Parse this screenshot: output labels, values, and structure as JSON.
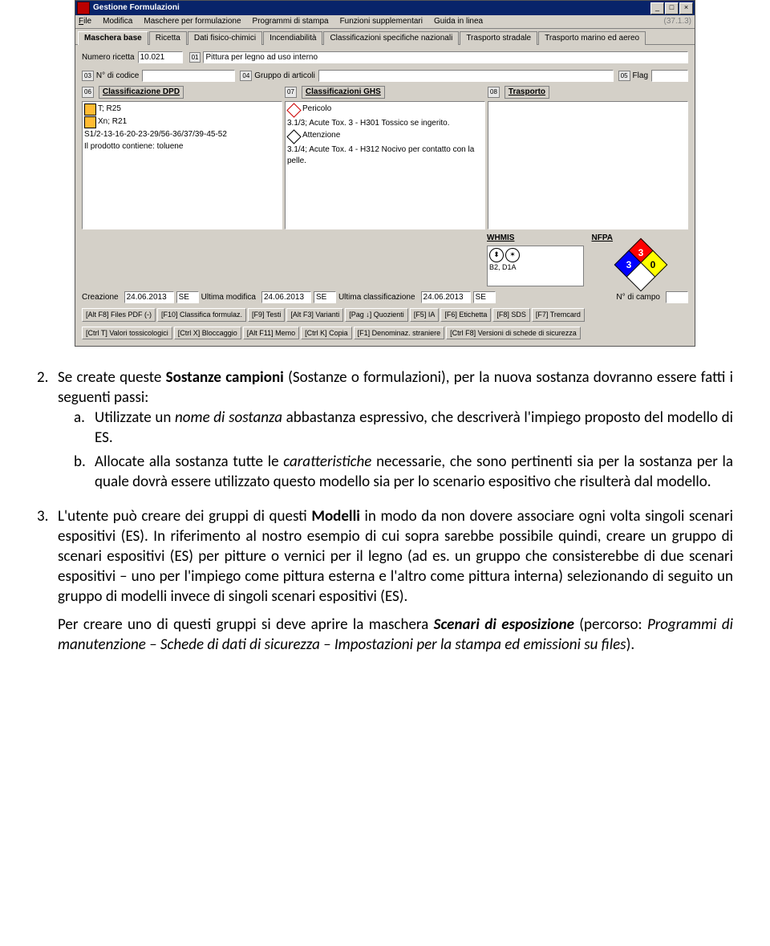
{
  "window": {
    "title": "Gestione Formulazioni",
    "version": "(37.1.3)",
    "btn_min": "_",
    "btn_max": "□",
    "btn_close": "×"
  },
  "menus": {
    "file": "File",
    "modifica": "Modifica",
    "maschere": "Maschere per formulazione",
    "programmi": "Programmi di stampa",
    "funzioni": "Funzioni supplementari",
    "guida": "Guida in linea"
  },
  "tabs": [
    "Maschera base",
    "Ricetta",
    "Dati fisico-chimici",
    "Incendiabilità",
    "Classificazioni specifiche nazionali",
    "Trasporto stradale",
    "Trasporto marino ed aereo"
  ],
  "form": {
    "numero_ricetta_lbl": "Numero ricetta",
    "numero_ricetta_val": "10.021",
    "tag01": "01",
    "desc_val": "Pittura per legno ad uso interno",
    "tag03": "03",
    "n_codice_lbl": "N° di codice",
    "n_codice_val": "",
    "tag04": "04",
    "gruppo_lbl": "Gruppo di articoli",
    "gruppo_val": "",
    "tag05": "05",
    "flag_lbl": "Flag",
    "flag_val": "",
    "tag06": "06",
    "sec_dpd": "Classificazione DPD",
    "tag07": "07",
    "sec_ghs": "Classificazioni GHS",
    "tag08": "08",
    "sec_trasporto": "Trasporto"
  },
  "dpd_lines": [
    "T; R25",
    "Xn; R21",
    "S1/2-13-16-20-23-29/56-36/37/39-45-52",
    "Il prodotto contiene: toluene"
  ],
  "ghs_lines": [
    "Pericolo",
    "3.1/3; Acute Tox. 3 - H301 Tossico se ingerito.",
    "Attenzione",
    "3.1/4; Acute Tox. 4 - H312 Nocivo per contatto con la pelle."
  ],
  "whmis": {
    "hdr": "WHMIS",
    "sym1": "⬤",
    "sym2": "✶",
    "val": "B2, D1A"
  },
  "nfpa": {
    "hdr": "NFPA",
    "red": "3",
    "blue": "3",
    "yellow": "0",
    "white": ""
  },
  "dates": {
    "creazione_lbl": "Creazione",
    "creazione_val": "24.06.2013",
    "se1": "SE",
    "ultima_mod_lbl": "Ultima modifica",
    "ultima_mod_val": "24.06.2013",
    "se2": "SE",
    "ultima_class_lbl": "Ultima classificazione",
    "ultima_class_val": "24.06.2013",
    "se3": "SE",
    "campo_lbl": "N° di campo",
    "campo_val": ""
  },
  "buttons_row1": [
    "[Alt F8] Files PDF (-)",
    "[F10] Classifica formulaz.",
    "[F9] Testi",
    "[Alt F3] Varianti",
    "[Pag ↓] Quozienti",
    "[F5] IA",
    "[F6] Etichetta",
    "[F8] SDS",
    "[F7] Tremcard"
  ],
  "buttons_row2": [
    "[Ctrl T] Valori tossicologici",
    "[Ctrl X] Bloccaggio",
    "[Alt F11] Memo",
    "[Ctrl K] Copia",
    "[F1] Denominaz. straniere",
    "[Ctrl F8] Versioni di schede di sicurezza"
  ],
  "doc": {
    "p1_num": "2.",
    "p1_a": "Se create queste ",
    "p1_b": "Sostanze campioni ",
    "p1_c": "(Sostanze o formulazioni), per la nuova sostanza dovranno essere fatti i seguenti passi:",
    "a_num": "a.",
    "a1": "Utilizzate un ",
    "a2": "nome di sostanza",
    "a3": " abbastanza espressivo, che descriverà l'impiego proposto del modello di ES.",
    "b_num": "b.",
    "b1": "Allocate alla sostanza tutte le ",
    "b2": "caratteristiche",
    "b3": " necessarie, che sono pertinenti sia per la sostanza per la quale dovrà essere utilizzato questo modello sia per lo scenario espositivo che risulterà dal modello.",
    "p3_num": "3.",
    "p3_a": "L'utente può creare dei gruppi di questi ",
    "p3_b": "Modelli",
    "p3_c": " in modo da non dovere associare ogni volta singoli scenari espositivi (ES). In riferimento al nostro esempio di cui sopra sarebbe possibile quindi, creare un gruppo di scenari espositivi (ES) per pitture o vernici per il legno (ad es. un gruppo che consisterebbe di due scenari espositivi – uno per l'impiego come pittura esterna e l'altro come pittura interna) selezionando di seguito un gruppo di modelli invece di singoli scenari espositivi (ES).",
    "p4_a": "Per creare uno di questi gruppi si deve aprire la maschera ",
    "p4_b": "Scenari di esposizione",
    "p4_c": " (percorso: ",
    "p4_d": "Programmi di manutenzione – Schede di dati di sicurezza – Impostazioni per la stampa ed emissioni su files",
    "p4_e": ")."
  }
}
